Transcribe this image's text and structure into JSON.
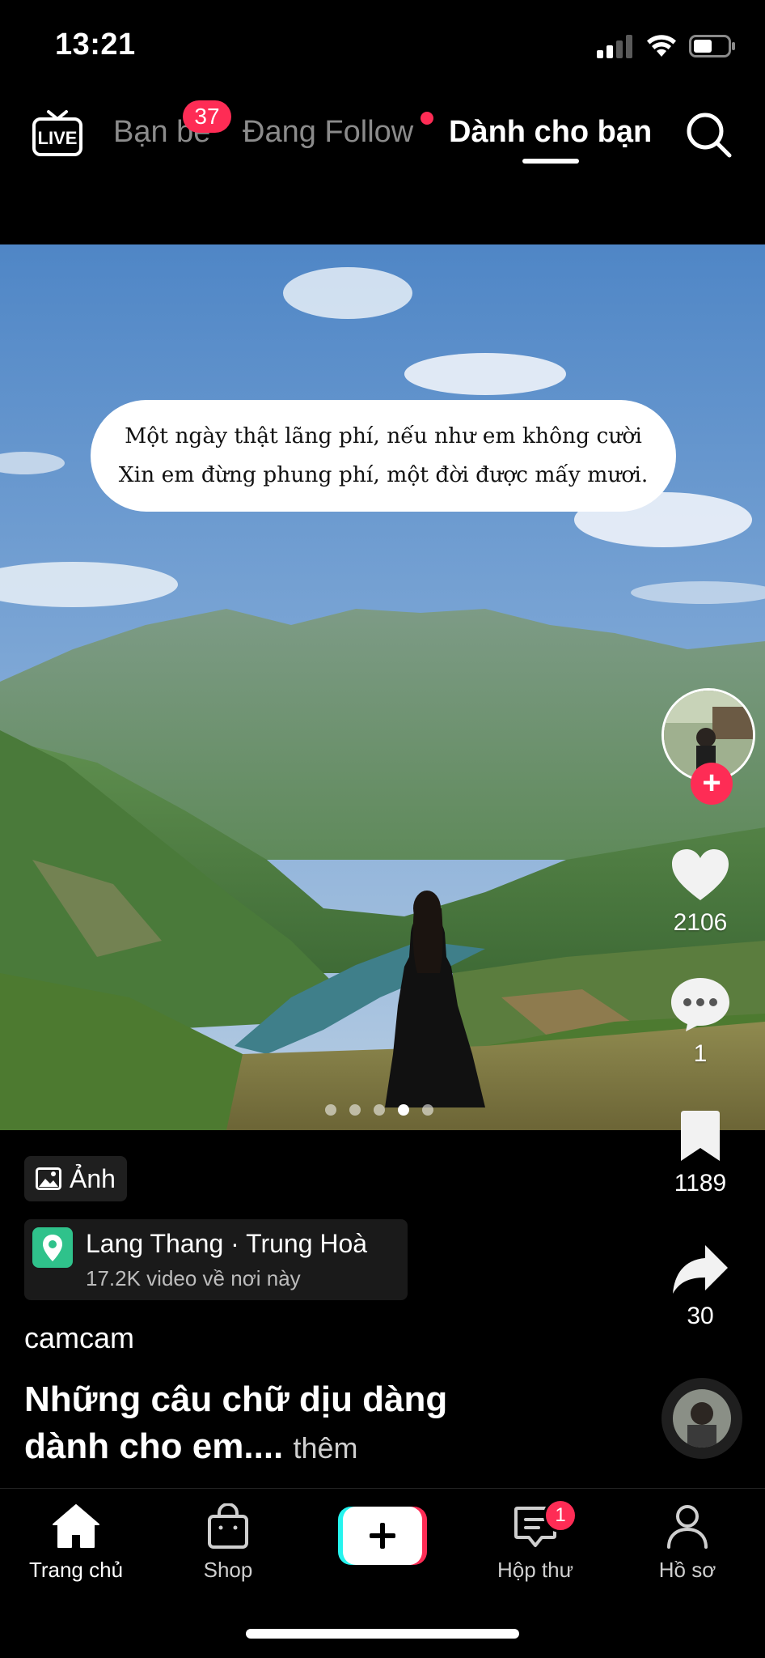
{
  "status_bar": {
    "time": "13:21",
    "icons": [
      "signal-icon",
      "wifi-icon",
      "battery-icon"
    ]
  },
  "top_nav": {
    "live_icon": "live-tv-icon",
    "tabs": [
      {
        "label": "Bạn bè",
        "badge": "37"
      },
      {
        "label": "Đang Follow",
        "dot": true
      },
      {
        "label": "Dành cho bạn",
        "active": true
      }
    ],
    "search_icon": "search-icon"
  },
  "photo": {
    "quote_line1": "Một ngày thật lãng phí, nếu như em không cười",
    "quote_line2": "Xin em đừng phung phí, một đời được mấy mươi.",
    "carousel": {
      "total": 5,
      "active_index": 3
    }
  },
  "actions": {
    "likes": "2106",
    "comments": "1",
    "saves": "1189",
    "shares": "30"
  },
  "post": {
    "type_label": "Ảnh",
    "location_title": "Lang Thang · Trung Hoà",
    "location_sub": "17.2K video về nơi này",
    "username": "camcam",
    "caption": "Những câu chữ dịu dàng dành cho em....",
    "more_label": "thêm"
  },
  "tabbar": {
    "home": "Trang chủ",
    "shop": "Shop",
    "inbox": "Hộp thư",
    "inbox_badge": "1",
    "profile": "Hồ sơ"
  },
  "colors": {
    "accent": "#fe2c55",
    "location_green": "#2fc28b"
  }
}
